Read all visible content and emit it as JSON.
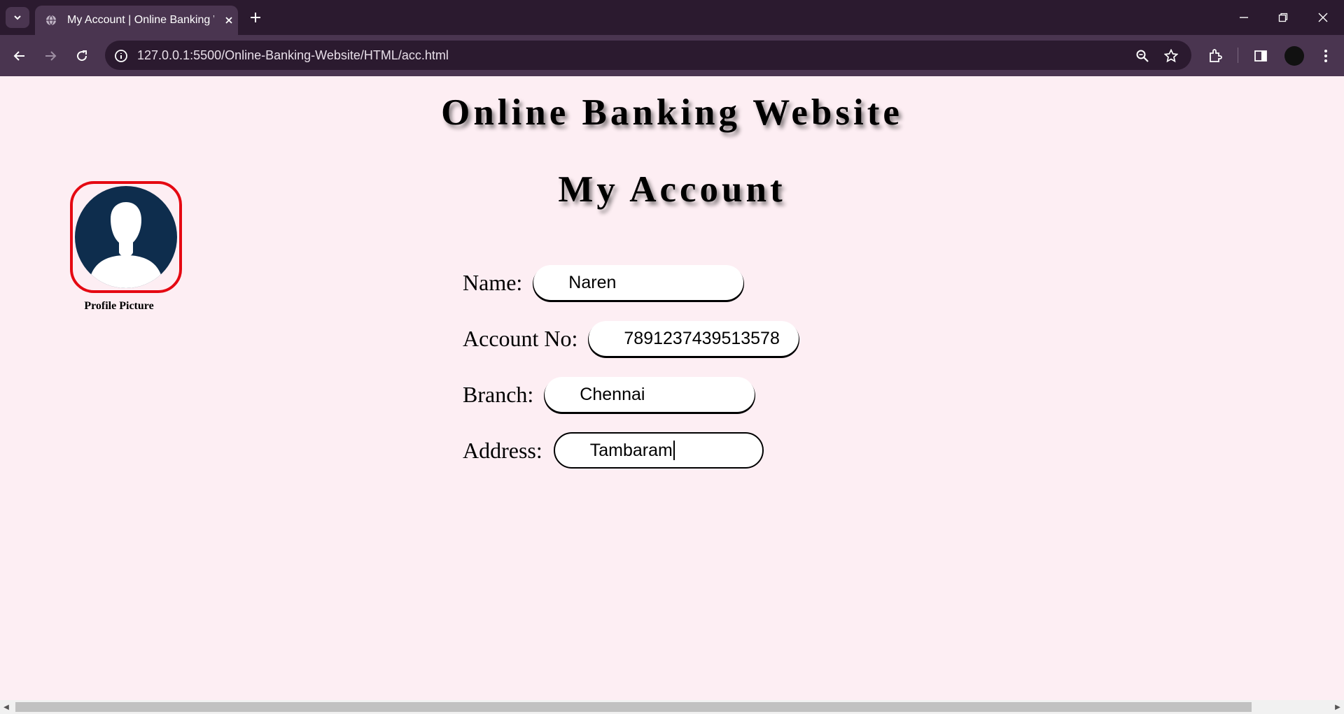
{
  "browser": {
    "tab_title": "My Account | Online Banking W",
    "url": "127.0.0.1:5500/Online-Banking-Website/HTML/acc.html"
  },
  "page": {
    "site_title": "Online Banking Website",
    "heading": "My Account",
    "profile_caption": "Profile Picture",
    "fields": [
      {
        "label": "Name:",
        "value": "Naren"
      },
      {
        "label": "Account No:",
        "value": "7891237439513578"
      },
      {
        "label": "Branch:",
        "value": "Chennai"
      },
      {
        "label": "Address:",
        "value": "Tambaram"
      }
    ]
  },
  "colors": {
    "page_bg": "#fdeef3",
    "chrome_dark": "#2b1a2f",
    "chrome_light": "#4a3550",
    "profile_border": "#e50912",
    "avatar_fill": "#0e2d4d"
  }
}
